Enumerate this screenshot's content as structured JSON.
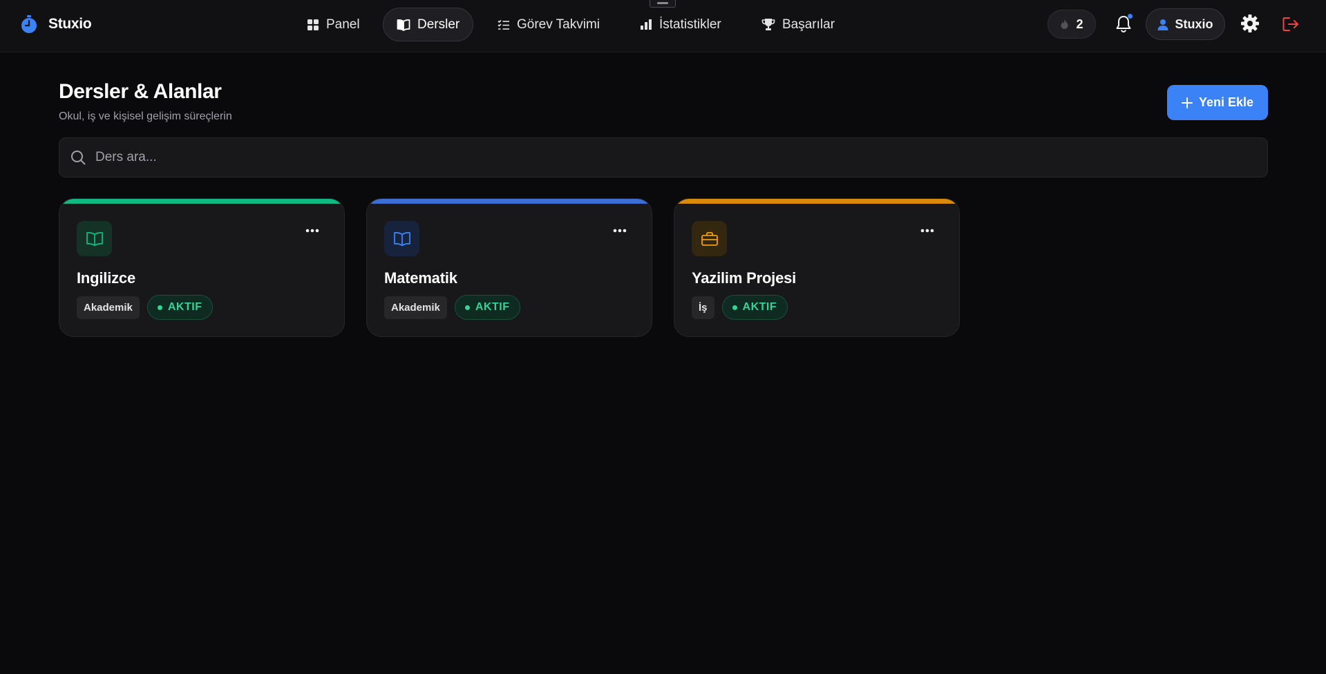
{
  "app": {
    "name": "Stuxio"
  },
  "nav": {
    "items": [
      {
        "label": "Panel",
        "icon": "grid-icon",
        "active": false
      },
      {
        "label": "Dersler",
        "icon": "book-open-icon",
        "active": true
      },
      {
        "label": "Görev Takvimi",
        "icon": "list-checks-icon",
        "active": false
      },
      {
        "label": "İstatistikler",
        "icon": "bar-chart-icon",
        "active": false
      },
      {
        "label": "Başarılar",
        "icon": "trophy-icon",
        "active": false
      }
    ]
  },
  "toolbar": {
    "streak_count": "2",
    "user_name": "Stuxio",
    "notification_badge": true
  },
  "page": {
    "title": "Dersler & Alanlar",
    "subtitle": "Okul, iş ve kişisel gelişim süreçlerin",
    "add_button_label": "Yeni Ekle"
  },
  "search": {
    "placeholder": "Ders ara...",
    "value": ""
  },
  "colors": {
    "accent": "#3b82f6",
    "green": "#10b981",
    "blue": "#3b82f6",
    "amber": "#f59e0b",
    "danger": "#ef4444",
    "status_active": "#34d399"
  },
  "courses": [
    {
      "title": "Ingilizce",
      "category": "Akademik",
      "status": "AKTIF",
      "icon": "book-open-icon",
      "color": "#10b981"
    },
    {
      "title": "Matematik",
      "category": "Akademik",
      "status": "AKTIF",
      "icon": "book-open-icon",
      "color": "#3b82f6"
    },
    {
      "title": "Yazilim Projesi",
      "category": "İş",
      "status": "AKTIF",
      "icon": "briefcase-icon",
      "color": "#f59e0b"
    }
  ]
}
